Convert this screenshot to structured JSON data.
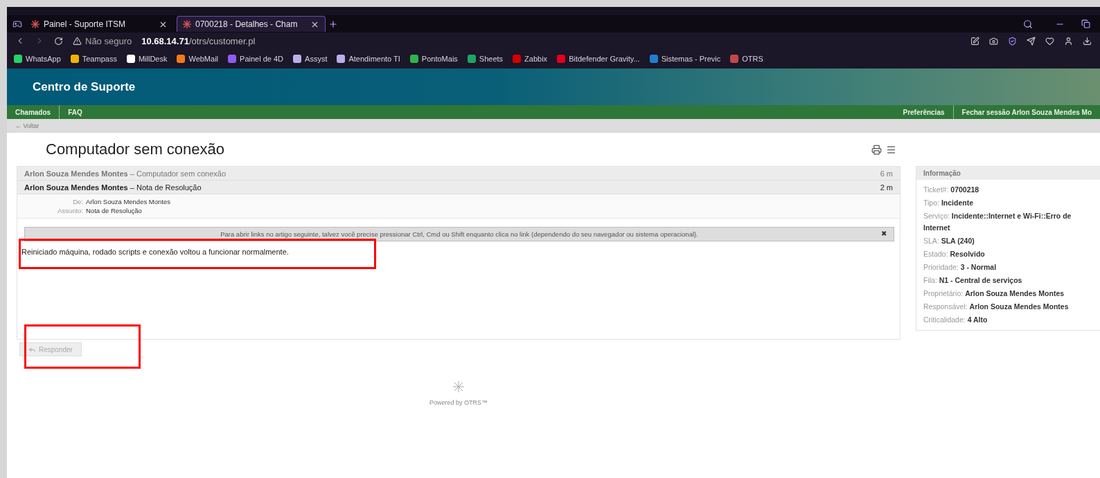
{
  "browser": {
    "tabs": [
      {
        "label": "Painel - Suporte ITSM",
        "selected": false
      },
      {
        "label": "0700218 - Detalhes - Cham",
        "selected": true
      }
    ],
    "address": {
      "security": "Não seguro",
      "host": "10.68.14.71",
      "path": "/otrs/customer.pl"
    },
    "bookmarks": [
      {
        "label": "WhatsApp",
        "color": "#25d366"
      },
      {
        "label": "Teampass",
        "color": "#f0b400"
      },
      {
        "label": "MillDesk",
        "color": "#ffffff"
      },
      {
        "label": "WebMail",
        "color": "#f27a1a"
      },
      {
        "label": "Painel de 4D",
        "color": "#8e5cf0"
      },
      {
        "label": "Assyst",
        "color": "#b8b0e8"
      },
      {
        "label": "Atendimento TI",
        "color": "#b8b0e8"
      },
      {
        "label": "PontoMais",
        "color": "#2fb24c"
      },
      {
        "label": "Sheets",
        "color": "#1fa463"
      },
      {
        "label": "Zabbix",
        "color": "#d40000"
      },
      {
        "label": "Bitdefender Gravity...",
        "color": "#e2001a"
      },
      {
        "label": "Sistemas - Previc",
        "color": "#1e7fd0"
      },
      {
        "label": "OTRS",
        "color": "#c04848"
      }
    ]
  },
  "header": {
    "title": "Centro de Suporte"
  },
  "nav": {
    "left": [
      "Chamados",
      "FAQ"
    ],
    "right": [
      "Preferências",
      "Fechar sessão Arlon Souza Mendes Mo"
    ]
  },
  "back_link": "← Voltar",
  "ticket_title": "Computador sem conexão",
  "article_separator": "–",
  "articles": [
    {
      "author": "Arlon Souza Mendes Montes",
      "subject": "Computador sem conexão",
      "age": "6 m",
      "selected": false
    },
    {
      "author": "Arlon Souza Mendes Montes",
      "subject": "Nota de Resolução",
      "age": "2 m",
      "selected": true
    }
  ],
  "article_detail": {
    "fields": [
      {
        "label": "De:",
        "value": "Arlon Souza Mendes Montes"
      },
      {
        "label": "Assunto:",
        "value": "Nota de Resolução"
      }
    ],
    "notice": "Para abrir links no artigo seguinte, talvez você precise pressionar Ctrl, Cmd ou Shift enquanto clica no link (dependendo do seu navegador ou sistema operacional).",
    "close": "✖",
    "body": "Reiniciado máquina, rodado scripts e conexão voltou a funcionar normalmente."
  },
  "reply_button": {
    "label": "Responder",
    "disabled": true
  },
  "info": {
    "title": "Informação",
    "fields": [
      {
        "label": "Ticket#:",
        "value": "0700218"
      },
      {
        "label": "Tipo:",
        "value": "Incidente"
      },
      {
        "label": "Serviço:",
        "value": "Incidente::Internet e Wi-Fi::Erro de Internet"
      },
      {
        "label": "SLA:",
        "value": "SLA (240)"
      },
      {
        "label": "Estado:",
        "value": "Resolvido"
      },
      {
        "label": "Prioridade:",
        "value": "3 - Normal"
      },
      {
        "label": "Fila:",
        "value": "N1 - Central de serviços"
      },
      {
        "label": "Proprietário:",
        "value": "Arlon Souza Mendes Montes"
      },
      {
        "label": "Responsável:",
        "value": "Arlon Souza Mendes Montes"
      },
      {
        "label": "Criticalidade:",
        "value": "4 Alto"
      }
    ]
  },
  "footer": "Powered by OTRS™"
}
